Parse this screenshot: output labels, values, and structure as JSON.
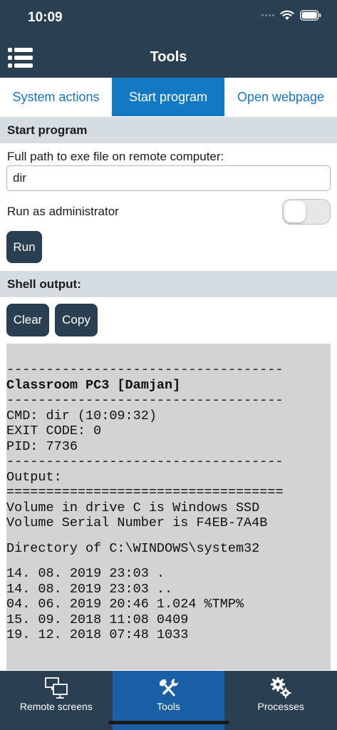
{
  "status_bar": {
    "time": "10:09"
  },
  "header": {
    "title": "Tools",
    "menu_icon": "menu-list-icon"
  },
  "tabs": [
    {
      "label": "System actions",
      "active": false
    },
    {
      "label": "Start program",
      "active": true
    },
    {
      "label": "Open webpage",
      "active": false
    }
  ],
  "start_program": {
    "section_title": "Start program",
    "path_label": "Full path to exe file on remote computer:",
    "path_value": "dir",
    "admin_label": "Run as administrator",
    "admin_enabled": false,
    "run_label": "Run"
  },
  "shell_output": {
    "section_title": "Shell output:",
    "clear_label": "Clear",
    "copy_label": "Copy",
    "lines": [
      "-----------------------------------",
      "Classroom PC3 [Damjan]",
      "-----------------------------------",
      "CMD: dir (10:09:32)",
      "EXIT CODE: 0",
      "PID: 7736",
      "-----------------------------------",
      "Output:",
      "===================================",
      "Volume in drive C is Windows SSD",
      "Volume Serial Number is F4EB-7A4B",
      "",
      "Directory of C:\\WINDOWS\\system32",
      "",
      "14. 08. 2019 23:03 .",
      "14. 08. 2019 23:03 ..",
      "04. 06. 2019 20:46 1.024 %TMP%",
      "15. 09. 2018 11:08 0409",
      "19. 12. 2018 07:48 1033"
    ]
  },
  "bottom_nav": [
    {
      "label": "Remote screens",
      "icon": "monitors-icon",
      "active": false
    },
    {
      "label": "Tools",
      "icon": "tools-icon",
      "active": true
    },
    {
      "label": "Processes",
      "icon": "gears-icon",
      "active": false
    }
  ],
  "colors": {
    "primary": "#2b3f52",
    "accent": "#1279c5",
    "section_bg": "#d6dde2",
    "console_bg": "#d3d3d3"
  }
}
